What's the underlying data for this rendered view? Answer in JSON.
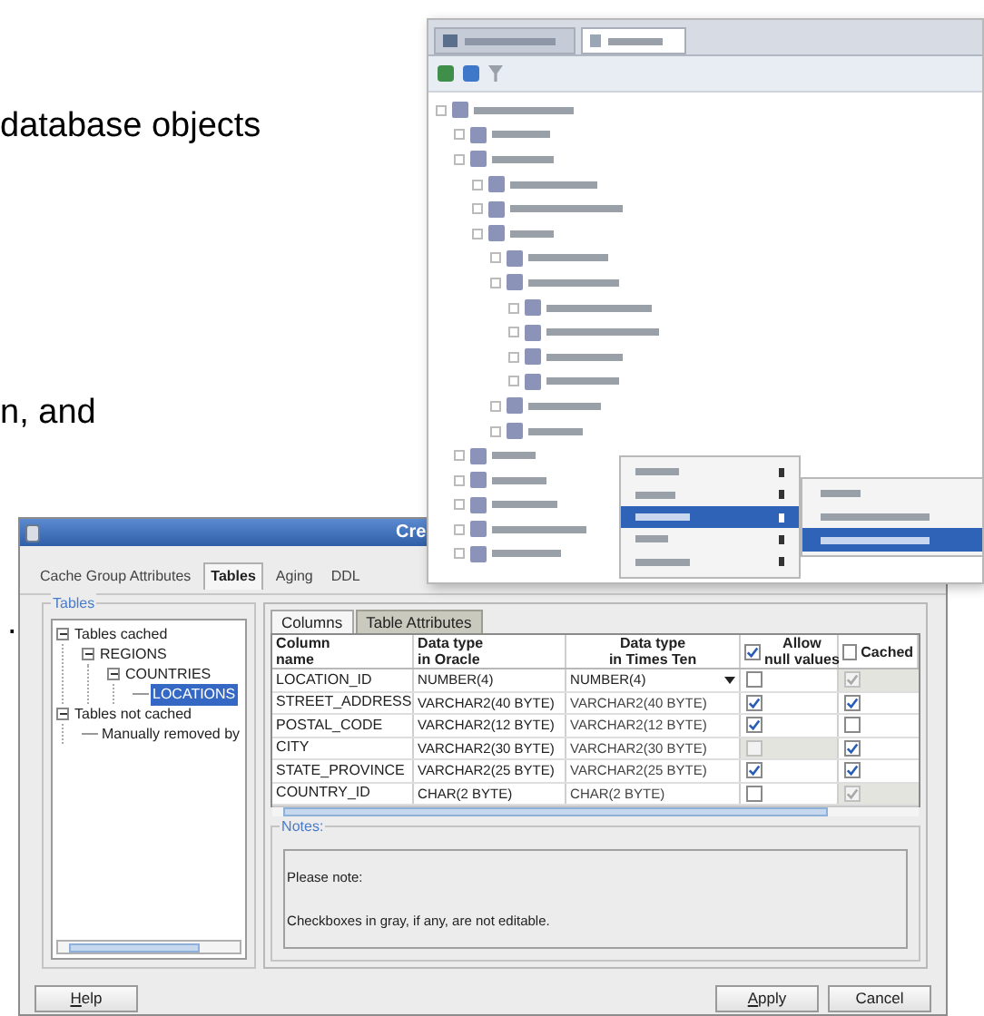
{
  "document_text": [
    {
      "text": "database objects"
    },
    {
      "text": "n, and"
    },
    {
      "text": "."
    }
  ],
  "dialog": {
    "title": "Cre",
    "tabs": [
      {
        "label": "Cache Group Attributes",
        "selected": false
      },
      {
        "label": "Tables",
        "selected": true
      },
      {
        "label": "Aging",
        "selected": false
      },
      {
        "label": "DDL",
        "selected": false
      }
    ],
    "tables_group": {
      "title": "Tables",
      "tree": [
        {
          "label": "Tables cached",
          "expanded": true,
          "selected": false,
          "children": [
            {
              "label": "REGIONS",
              "expanded": true,
              "selected": false,
              "children": [
                {
                  "label": "COUNTRIES",
                  "expanded": true,
                  "selected": false,
                  "children": [
                    {
                      "label": "LOCATIONS",
                      "selected": true
                    }
                  ]
                }
              ]
            }
          ]
        },
        {
          "label": "Tables not cached",
          "expanded": true,
          "selected": false,
          "children": [
            {
              "label": "Manually removed by",
              "selected": false
            }
          ]
        }
      ]
    },
    "subtabs": [
      {
        "label": "Columns",
        "selected": true
      },
      {
        "label": "Table Attributes",
        "selected": false
      }
    ],
    "grid": {
      "columns": [
        {
          "lines": [
            "Column",
            "name"
          ]
        },
        {
          "lines": [
            "Data type",
            "in Oracle"
          ]
        },
        {
          "lines": [
            "Data type",
            "in Times Ten"
          ]
        },
        {
          "lines": [
            "Allow",
            "null values"
          ],
          "checked": true
        },
        {
          "lines": [
            "Cached"
          ],
          "checked": false
        }
      ],
      "rows": [
        {
          "name": "LOCATION_ID",
          "oracle": "NUMBER(4)",
          "times_ten": "NUMBER(4)",
          "times_ten_dropdown": true,
          "allow_null": {
            "checked": false,
            "disabled": false
          },
          "cached": {
            "checked": true,
            "disabled": true
          }
        },
        {
          "name": "STREET_ADDRESS",
          "oracle": "VARCHAR2(40 BYTE)",
          "times_ten": "VARCHAR2(40 BYTE)",
          "times_ten_dropdown": false,
          "allow_null": {
            "checked": true,
            "disabled": false
          },
          "cached": {
            "checked": true,
            "disabled": false
          }
        },
        {
          "name": "POSTAL_CODE",
          "oracle": "VARCHAR2(12 BYTE)",
          "times_ten": "VARCHAR2(12 BYTE)",
          "times_ten_dropdown": false,
          "allow_null": {
            "checked": true,
            "disabled": false
          },
          "cached": {
            "checked": false,
            "disabled": false
          }
        },
        {
          "name": "CITY",
          "oracle": "VARCHAR2(30 BYTE)",
          "times_ten": "VARCHAR2(30 BYTE)",
          "times_ten_dropdown": false,
          "allow_null": {
            "checked": false,
            "disabled": true
          },
          "cached": {
            "checked": true,
            "disabled": false
          }
        },
        {
          "name": "STATE_PROVINCE",
          "oracle": "VARCHAR2(25 BYTE)",
          "times_ten": "VARCHAR2(25 BYTE)",
          "times_ten_dropdown": false,
          "allow_null": {
            "checked": true,
            "disabled": false
          },
          "cached": {
            "checked": true,
            "disabled": false
          }
        },
        {
          "name": "COUNTRY_ID",
          "oracle": "CHAR(2 BYTE)",
          "times_ten": "CHAR(2 BYTE)",
          "times_ten_dropdown": false,
          "allow_null": {
            "checked": false,
            "disabled": false
          },
          "cached": {
            "checked": true,
            "disabled": true
          }
        }
      ]
    },
    "notes": {
      "title": "Notes:",
      "lines": [
        "Please note:",
        "Checkboxes in gray, if any, are not editable."
      ]
    },
    "buttons": [
      {
        "label": "Help",
        "mnemonic_underlined": true
      },
      {
        "label": "Apply",
        "mnemonic_underlined": true
      },
      {
        "label": "Cancel",
        "mnemonic_underlined": false
      }
    ]
  }
}
